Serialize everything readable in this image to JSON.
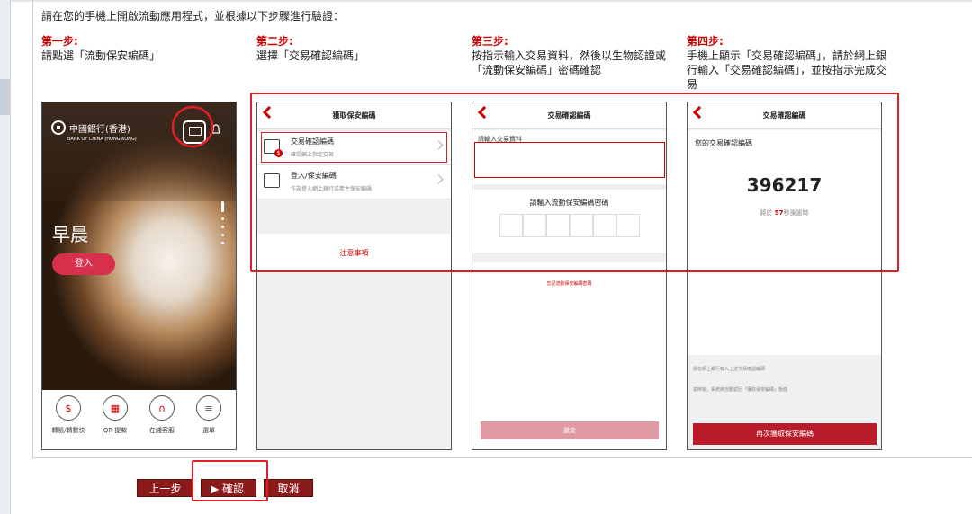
{
  "intro": "請在您的手機上開啟流動應用程式，並根據以下步驟進行驗證：",
  "steps": [
    {
      "title": "第一步:",
      "text": "請點選「流動保安編碼」"
    },
    {
      "title": "第二步:",
      "text": "選擇「交易確認編碼」"
    },
    {
      "title": "第三步:",
      "text": "按指示輸入交易資料，然後以生物認證或「流動保安編碼」密碼確認"
    },
    {
      "title": "第四步:",
      "text": "手機上顯示「交易確認編碼」，請於網上銀行輸入「交易確認編碼」，並按指示完成交易"
    }
  ],
  "phone1": {
    "bank_name": "中國銀行(香港)",
    "bank_sub": "BANK OF CHINA (HONG KONG)",
    "greeting": "早晨",
    "login": "登入",
    "nav": [
      {
        "label": "轉賬/轉數快",
        "icon": "transfer-icon"
      },
      {
        "label": "QR 提款",
        "icon": "qr-icon"
      },
      {
        "label": "在綫客服",
        "icon": "headset-icon"
      },
      {
        "label": "選單",
        "icon": "menu-icon"
      }
    ]
  },
  "phone2": {
    "title": "獲取保安編碼",
    "items": [
      {
        "title": "交易確認編碼",
        "sub": "確認網上指定交易"
      },
      {
        "title": "登入/保安編碼",
        "sub": "作為登入網上銀行或產生保安編碼"
      }
    ],
    "notice": "注意事項"
  },
  "phone3": {
    "title": "交易確認編碼",
    "field_label": "請輸入交易資料",
    "pin_label": "請輸入流動保安編碼密碼",
    "forgot": "忘記流動保安編碼密碼",
    "submit": "遞交"
  },
  "phone4": {
    "title": "交易確認編碼",
    "code_label": "您的交易確認編碼",
    "code": "396217",
    "timeout_prefix": "將於 ",
    "timeout_secs": "57",
    "timeout_suffix": "秒後逾時",
    "hint1": "請在網上銀行輸入上述交易確認編碼",
    "hint2": "逾時後，系統將自動返回「獲取保安編碼」版面",
    "reget": "再次獲取保安編碼"
  },
  "buttons": {
    "prev": "上一步",
    "confirm": "確認",
    "cancel": "取消"
  },
  "colors": {
    "accent_red": "#e01f26",
    "button_dark_red": "#8b1a1a"
  }
}
